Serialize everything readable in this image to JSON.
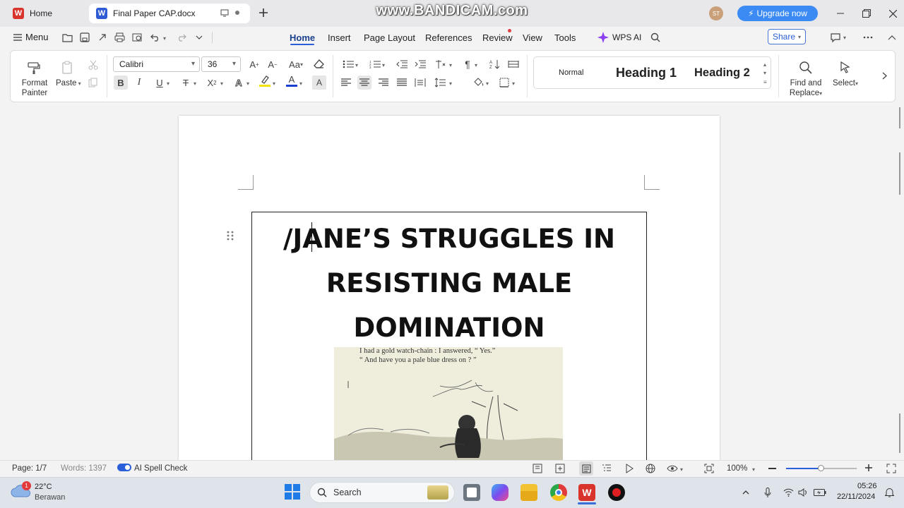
{
  "tabs": [
    {
      "label": "Home"
    },
    {
      "label": "Final Paper CAP.docx"
    }
  ],
  "watermark": "www.BANDICAM.com",
  "account": {
    "initials": "ST",
    "upgrade_label": "Upgrade now"
  },
  "menu": {
    "menu_label": "Menu",
    "items": [
      "Home",
      "Insert",
      "Page Layout",
      "References",
      "Review",
      "View",
      "Tools"
    ],
    "wps_ai": "WPS AI",
    "share": "Share"
  },
  "ribbon": {
    "format_painter": "Format Painter",
    "paste": "Paste",
    "font_name": "Calibri",
    "font_size": "36",
    "bold": "B",
    "italic": "I",
    "underline": "U",
    "styles": [
      "Normal",
      "Heading 1",
      "Heading 2"
    ],
    "find_replace": "Find and Replace",
    "select": "Select"
  },
  "document": {
    "title_lines": [
      "/JANE’S STRUGGLES IN",
      "RESISTING MALE",
      "DOMINATION"
    ],
    "caption_lines": [
      "I had a gold watch-chain :  I answered, “ Yes.”",
      "“ And have you a pale blue dress on ? ”"
    ]
  },
  "status": {
    "page": "Page: 1/7",
    "words": "Words: 1397",
    "spell": "AI Spell Check",
    "zoom": "100%",
    "zoom_fraction": 0.5
  },
  "taskbar": {
    "weather_temp": "22°C",
    "weather_desc": "Berawan",
    "weather_badge": "1",
    "search_label": "Search",
    "time": "05:26",
    "date": "22/11/2024"
  },
  "colors": {
    "accent": "#2b5fd9",
    "upgrade": "#3c8bf5",
    "wps_red": "#d9342b",
    "word_blue": "#2f5bd4"
  }
}
